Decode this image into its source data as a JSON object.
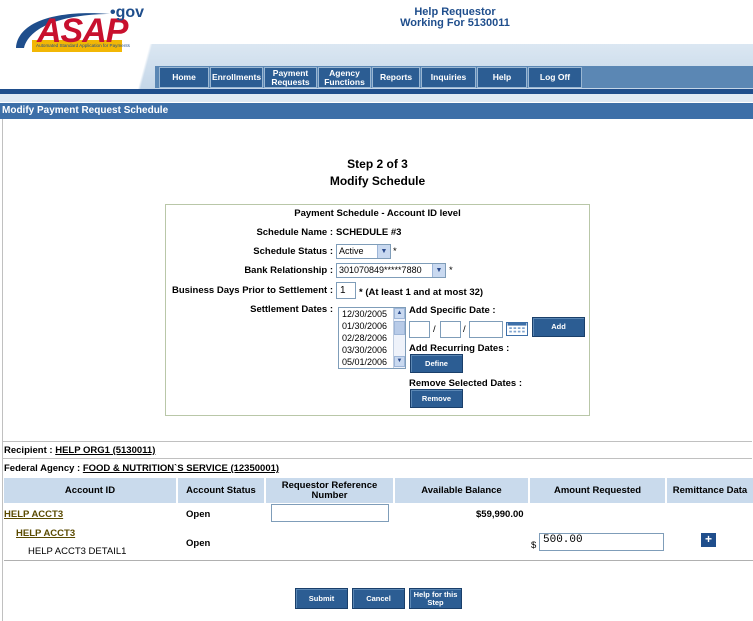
{
  "header": {
    "logo_text": "ASAP",
    "logo_suffix": "•gov",
    "logo_tagline": "Automated Standard Application for Payments",
    "user_line1": "Help Requestor",
    "user_line2": "Working For 5130011"
  },
  "nav": {
    "items": [
      {
        "label": "Home"
      },
      {
        "label": "Enrollments"
      },
      {
        "label": "Payment Requests"
      },
      {
        "label": "Agency Functions"
      },
      {
        "label": "Reports"
      },
      {
        "label": "Inquiries"
      },
      {
        "label": "Help"
      },
      {
        "label": "Log Off"
      }
    ]
  },
  "page_title": "Modify Payment Request Schedule",
  "step": {
    "line1": "Step 2 of 3",
    "line2": "Modify Schedule"
  },
  "schedule": {
    "heading": "Payment Schedule - Account ID level",
    "name_label": "Schedule Name :",
    "name_value": "SCHEDULE #3",
    "status_label": "Schedule Status :",
    "status_value": "Active",
    "status_required": "*",
    "bank_label": "Bank Relationship :",
    "bank_value": "301070849*****7880",
    "bank_required": "*",
    "days_label": "Business Days Prior to Settlement :",
    "days_value": "1",
    "days_hint": "* (At least 1 and at most 32)",
    "dates_label": "Settlement Dates :",
    "dates": [
      "12/30/2005",
      "01/30/2006",
      "02/28/2006",
      "03/30/2006",
      "05/01/2006"
    ],
    "add_specific_label": "Add Specific Date :",
    "date_sep": "/",
    "add_button": "Add",
    "add_recurring_label": "Add Recurring Dates :",
    "define_button": "Define",
    "remove_label": "Remove Selected Dates :",
    "remove_button": "Remove"
  },
  "recipient": {
    "label": "Recipient :",
    "value": "HELP ORG1 (5130011)"
  },
  "agency": {
    "label": "Federal Agency :",
    "value": "FOOD & NUTRITION`S SERVICE (12350001)"
  },
  "table": {
    "headers": [
      "Account ID",
      "Account Status",
      "Requestor Reference Number",
      "Available Balance",
      "Amount Requested",
      "Remittance Data"
    ],
    "row1": {
      "account": "HELP ACCT3",
      "status": "Open",
      "ref_number": "",
      "balance": "$59,990.00"
    },
    "row2": {
      "account": "HELP ACCT3",
      "detail": "HELP ACCT3 DETAIL1",
      "status": "Open",
      "currency": "$",
      "amount": "500.00",
      "remit_button": "+"
    }
  },
  "footer_buttons": {
    "submit": "Submit",
    "cancel": "Cancel",
    "help": "Help for this Step"
  },
  "colors": {
    "nav_bg": "#2c5d93",
    "title_bar": "#3d6fa8",
    "table_header": "#c9daec",
    "logo_red": "#c8102e"
  }
}
